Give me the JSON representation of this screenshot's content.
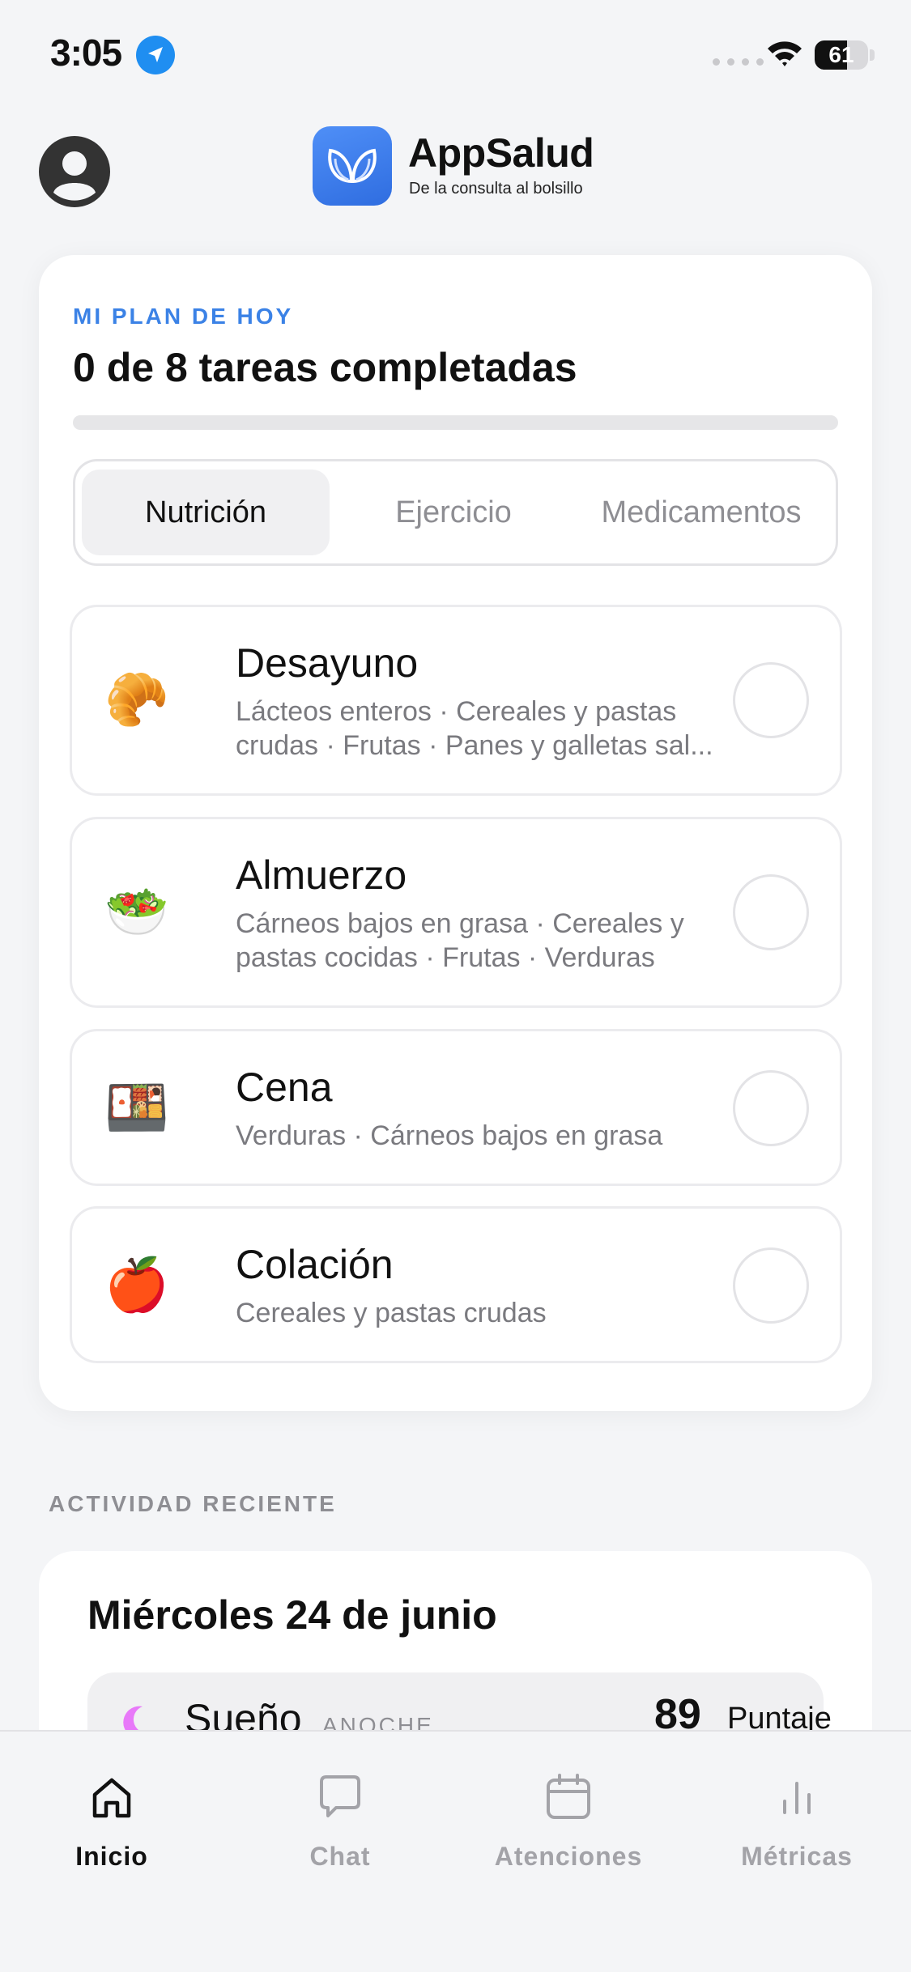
{
  "status_bar": {
    "time": "3:05",
    "battery": "61",
    "battery_level": 0.61
  },
  "header": {
    "app_name": "AppSalud",
    "tagline": "De la consulta al bolsillo"
  },
  "plan": {
    "eyebrow": "MI PLAN DE HOY",
    "summary": "0 de 8 tareas completadas",
    "completed": 0,
    "total": 8,
    "accent_color": "#3b82e6",
    "tabs": [
      {
        "label": "Nutrición",
        "active": true
      },
      {
        "label": "Ejercicio",
        "active": false
      },
      {
        "label": "Medicamentos",
        "active": false
      }
    ],
    "tasks": [
      {
        "icon": "croissant-icon",
        "emoji": "🥐",
        "title": "Desayuno",
        "desc": "Lácteos enteros · Cereales y pastas crudas · Frutas · Panes y galletas sal...",
        "done": false
      },
      {
        "icon": "salad-icon",
        "emoji": "🥗",
        "title": "Almuerzo",
        "desc": "Cárneos bajos en grasa · Cereales y pastas cocidas · Frutas · Verduras",
        "done": false
      },
      {
        "icon": "bento-box-icon",
        "emoji": "🍱",
        "title": "Cena",
        "desc": "Verduras · Cárneos bajos en grasa",
        "done": false
      },
      {
        "icon": "apple-icon",
        "emoji": "🍎",
        "title": "Colación",
        "desc": "Cereales y pastas crudas",
        "done": false
      }
    ]
  },
  "recent": {
    "label": "ACTIVIDAD RECIENTE",
    "day": "Miércoles 24 de junio",
    "sleep": {
      "title": "Sueño",
      "when": "ANOCHE",
      "score": "89",
      "score_label": "Puntaje",
      "icon": "moon-icon",
      "icon_color": "#e879f9"
    }
  },
  "nav": {
    "tabs": [
      {
        "label": "Inicio",
        "icon": "home-icon",
        "active": true
      },
      {
        "label": "Chat",
        "icon": "chat-icon",
        "active": false
      },
      {
        "label": "Atenciones",
        "icon": "calendar-icon",
        "active": false
      },
      {
        "label": "Métricas",
        "icon": "bar-chart-icon",
        "active": false
      }
    ]
  }
}
